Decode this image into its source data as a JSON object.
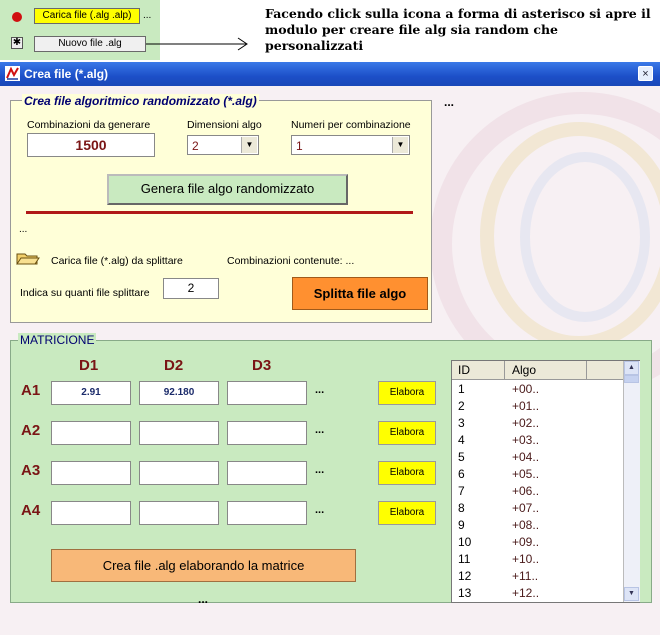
{
  "top": {
    "carica_label": "Carica file  (.alg .alp)",
    "carica_dots": "...",
    "nuovo_label": "Nuovo file .alg",
    "annotation": "Facendo click sulla icona a forma di asterisco si apre il modulo per creare file alg sia random che personalizzati"
  },
  "window": {
    "title": "Crea file (*.alg)",
    "close": "×"
  },
  "random_panel": {
    "title": "Crea file algoritmico randomizzato (*.alg)",
    "right_dots": "...",
    "comb_label": "Combinazioni da generare",
    "comb_value": "1500",
    "dim_label": "Dimensioni algo",
    "dim_value": "2",
    "num_label": "Numeri per combinazione",
    "num_value": "1",
    "genera_label": "Genera file algo randomizzato",
    "dots": "...",
    "carica_split_label": "Carica file (*.alg) da splittare",
    "comb_contenute_label": "Combinazioni contenute: ...",
    "indica_label": "Indica su quanti file splittare",
    "split_value": "2",
    "splitta_label": "Splitta file algo"
  },
  "matrice": {
    "title": "MATRICIONE",
    "columns": [
      "D1",
      "D2",
      "D3"
    ],
    "rows": [
      {
        "label": "A1",
        "d1": "2.91",
        "d2": "92.180",
        "d3": "",
        "dots": "...",
        "elabora": "Elabora"
      },
      {
        "label": "A2",
        "d1": "",
        "d2": "",
        "d3": "",
        "dots": "...",
        "elabora": "Elabora"
      },
      {
        "label": "A3",
        "d1": "",
        "d2": "",
        "d3": "",
        "dots": "...",
        "elabora": "Elabora"
      },
      {
        "label": "A4",
        "d1": "",
        "d2": "",
        "d3": "",
        "dots": "...",
        "elabora": "Elabora"
      }
    ],
    "crea_label": "Crea file .alg elaborando la matrice",
    "bottom_dots": "..."
  },
  "list": {
    "headers": [
      "ID",
      "Algo"
    ],
    "items": [
      {
        "id": "1",
        "algo": "+00.."
      },
      {
        "id": "2",
        "algo": "+01.."
      },
      {
        "id": "3",
        "algo": "+02.."
      },
      {
        "id": "4",
        "algo": "+03.."
      },
      {
        "id": "5",
        "algo": "+04.."
      },
      {
        "id": "6",
        "algo": "+05.."
      },
      {
        "id": "7",
        "algo": "+06.."
      },
      {
        "id": "8",
        "algo": "+07.."
      },
      {
        "id": "9",
        "algo": "+08.."
      },
      {
        "id": "10",
        "algo": "+09.."
      },
      {
        "id": "11",
        "algo": "+10.."
      },
      {
        "id": "12",
        "algo": "+11.."
      },
      {
        "id": "13",
        "algo": "+12.."
      }
    ]
  },
  "colors": {
    "title_bar": "#1c4fc8",
    "panel_yellow": "#ffffd8",
    "panel_green": "#c9eac0",
    "label_red": "#7a1515",
    "splitta_orange": "#ff9030"
  },
  "icons": {
    "record": "record-icon",
    "asterisk": "asterisk-icon",
    "arrow": "arrow-right-icon",
    "app": "app-icon",
    "folder": "folder-open-icon"
  }
}
